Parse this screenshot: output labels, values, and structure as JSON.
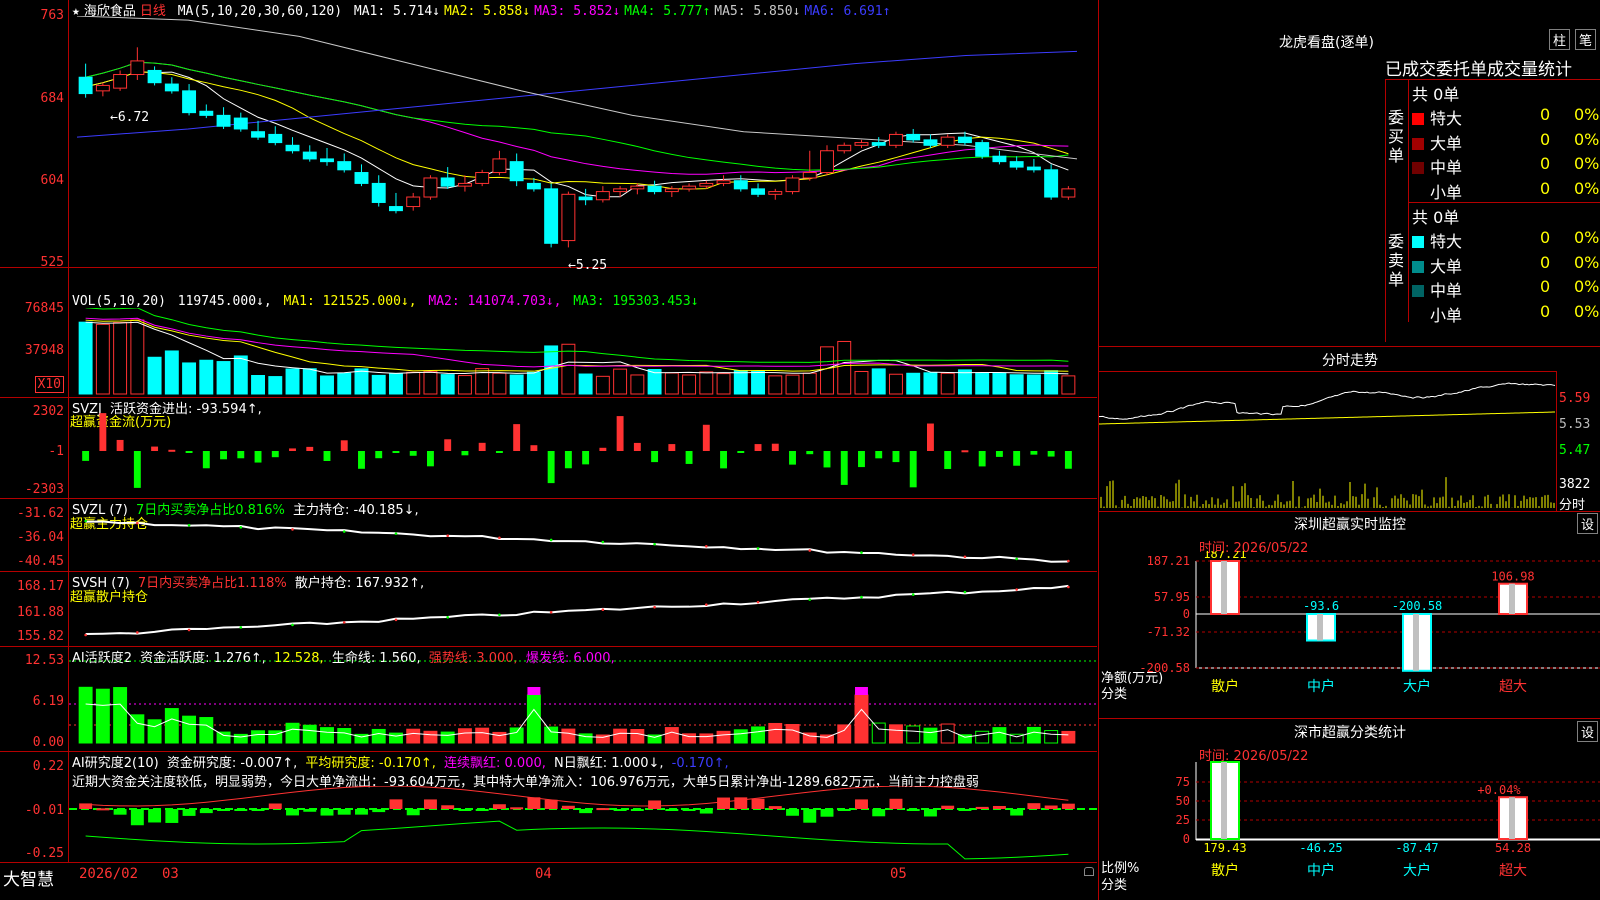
{
  "stock": {
    "star": "★",
    "name": "海欣食品",
    "period": "日线"
  },
  "kline_pane": {
    "ma_params": "MA(5,10,20,30,60,120)",
    "ma_values": [
      {
        "label": "MA1:",
        "value": "5.714↓",
        "color": "#ffffff"
      },
      {
        "label": "MA2:",
        "value": "5.858↓",
        "color": "#ffff00"
      },
      {
        "label": "MA3:",
        "value": "5.852↓",
        "color": "#ff00ff"
      },
      {
        "label": "MA4:",
        "value": "5.777↑",
        "color": "#00ff00"
      },
      {
        "label": "MA5:",
        "value": "5.850↓",
        "color": "#c8c8c8"
      },
      {
        "label": "MA6:",
        "value": "6.691↑",
        "color": "#3c3cff"
      }
    ],
    "y_ticks": [
      "763",
      "684",
      "604",
      "525"
    ],
    "annotations": {
      "high": "←6.72",
      "low": "←5.25"
    }
  },
  "vol_pane": {
    "title": "VOL(5,10,20)",
    "value": "119745.000↓,",
    "ma1": "MA1: 121525.000↓,",
    "ma2": "MA2: 141074.703↓,",
    "ma3": "MA3: 195303.453↓",
    "y_ticks": [
      "76845",
      "37948"
    ],
    "unit": "X10"
  },
  "svzj_pane": {
    "title": "SVZJ",
    "text": "活跃资金进出: -93.594↑,",
    "sub": "超赢资金流(万元)",
    "y_ticks": [
      "2302",
      "-1",
      "-2303"
    ]
  },
  "svzl_pane": {
    "title": "SVZL (7)",
    "text1": "7日内买卖净占比0.816%",
    "text2": "主力持仓: -40.185↓,",
    "sub": "超赢主力持仓",
    "y_ticks": [
      "-31.62",
      "-36.04",
      "-40.45"
    ]
  },
  "svsh_pane": {
    "title": "SVSH (7)",
    "text1": "7日内买卖净占比1.118%",
    "text2": "散户持仓: 167.932↑,",
    "sub": "超赢散户持仓",
    "y_ticks": [
      "168.17",
      "161.88",
      "155.82"
    ]
  },
  "ai_pane": {
    "title": "AI活跃度2",
    "t1": "资金活跃度: 1.276↑,",
    "t2": "12.528,",
    "t3": "生命线: 1.560,",
    "t4": "强势线: 3.000,",
    "t5": "爆发线: 6.000,",
    "y_ticks": [
      "12.53",
      "6.19",
      "0.00"
    ]
  },
  "ai2_pane": {
    "title": "AI研究度2(10)",
    "t1": "资金研究度: -0.007↑,",
    "t2": "平均研究度: -0.170↑,",
    "t3": "连续飘红: 0.000,",
    "t4": "N日飘红: 1.000↓,",
    "t5": "-0.170↑,",
    "summary": "近期大资金关注度较低，明显弱势，今日大单净流出：-93.604万元，其中特大单净流入：106.976万元，大单5日累计净出-1289.682万元，当前主力控盘弱",
    "y_ticks": [
      "0.22",
      "-0.01",
      "-0.25"
    ]
  },
  "bottom_bar": {
    "logo": "大智慧",
    "dates": [
      "2026/02",
      "03",
      "04",
      "05"
    ]
  },
  "right_panel": {
    "title": "龙虎看盘(逐单)",
    "btn1": "柱",
    "btn2": "笔",
    "tab": "已成交委托单成交量统计",
    "buy_group": {
      "label": "委买单",
      "total": "共 0单",
      "rows": [
        {
          "name": "特大",
          "count": "0",
          "pct": "0%",
          "color": "#ff0000"
        },
        {
          "name": "大单",
          "count": "0",
          "pct": "0%",
          "color": "#a00000"
        },
        {
          "name": "中单",
          "count": "0",
          "pct": "0%",
          "color": "#700000"
        },
        {
          "name": "小单",
          "count": "0",
          "pct": "0%",
          "color": "#000000"
        }
      ]
    },
    "sell_group": {
      "label": "委卖单",
      "total": "共 0单",
      "rows": [
        {
          "name": "特大",
          "count": "0",
          "pct": "0%",
          "color": "#00ffff"
        },
        {
          "name": "大单",
          "count": "0",
          "pct": "0%",
          "color": "#008c8c"
        },
        {
          "name": "中单",
          "count": "0",
          "pct": "0%",
          "color": "#006464"
        },
        {
          "name": "小单",
          "count": "0",
          "pct": "0%",
          "color": "#000000"
        }
      ]
    },
    "intraday": {
      "title": "分时走势",
      "y_ticks": [
        "5.59",
        "5.53",
        "5.47"
      ],
      "vol_tick": "3822",
      "vol_label": "分时"
    },
    "monitor": {
      "title": "深圳超赢实时监控",
      "setting": "设",
      "time": "时间: 2026/05/22",
      "y_ticks": [
        "187.21",
        "57.95",
        "0",
        "-71.32",
        "-200.58"
      ],
      "ylabel1": "净额(万元)",
      "ylabel2": "分类",
      "categories": [
        "散户",
        "中户",
        "大户",
        "超大"
      ],
      "values": [
        187.21,
        -93.6,
        -200.58,
        106.98
      ],
      "value_labels": [
        "187.21",
        "-93.6",
        "-200.58",
        "106.98"
      ]
    },
    "classify": {
      "title": "深市超赢分类统计",
      "setting": "设",
      "time": "时间: 2026/05/22",
      "y_ticks": [
        "75",
        "50",
        "25",
        "0"
      ],
      "ylabel1": "比例%",
      "ylabel2": "分类",
      "categories": [
        "散户",
        "中户",
        "大户",
        "超大"
      ],
      "pct_labels": [
        "",
        "",
        "",
        "+0.04%"
      ],
      "values": [
        179.43,
        -46.25,
        -87.47,
        54.28
      ],
      "value_labels": [
        "179.43",
        "-46.25",
        "-87.47",
        "54.28"
      ]
    }
  },
  "chart_data": {
    "type": "candlestick",
    "title": "海欣食品 日线",
    "y_range": [
      5.25,
      6.72
    ],
    "candles_ohlc": [
      [
        6.5,
        6.6,
        6.35,
        6.38
      ],
      [
        6.4,
        6.46,
        6.36,
        6.44
      ],
      [
        6.42,
        6.55,
        6.4,
        6.52
      ],
      [
        6.52,
        6.72,
        6.48,
        6.62
      ],
      [
        6.55,
        6.58,
        6.44,
        6.46
      ],
      [
        6.45,
        6.5,
        6.38,
        6.4
      ],
      [
        6.4,
        6.45,
        6.22,
        6.24
      ],
      [
        6.25,
        6.3,
        6.2,
        6.22
      ],
      [
        6.22,
        6.28,
        6.12,
        6.14
      ],
      [
        6.2,
        6.24,
        6.1,
        6.12
      ],
      [
        6.1,
        6.18,
        6.04,
        6.06
      ],
      [
        6.08,
        6.14,
        6.0,
        6.02
      ],
      [
        6.0,
        6.06,
        5.94,
        5.96
      ],
      [
        5.95,
        6.0,
        5.88,
        5.9
      ],
      [
        5.9,
        5.98,
        5.85,
        5.88
      ],
      [
        5.88,
        5.94,
        5.8,
        5.82
      ],
      [
        5.8,
        5.86,
        5.7,
        5.72
      ],
      [
        5.72,
        5.78,
        5.55,
        5.58
      ],
      [
        5.55,
        5.65,
        5.5,
        5.52
      ],
      [
        5.55,
        5.65,
        5.52,
        5.62
      ],
      [
        5.62,
        5.78,
        5.6,
        5.76
      ],
      [
        5.76,
        5.84,
        5.68,
        5.7
      ],
      [
        5.7,
        5.78,
        5.66,
        5.72
      ],
      [
        5.72,
        5.82,
        5.7,
        5.8
      ],
      [
        5.8,
        5.96,
        5.78,
        5.9
      ],
      [
        5.88,
        5.94,
        5.7,
        5.74
      ],
      [
        5.72,
        5.76,
        5.66,
        5.68
      ],
      [
        5.68,
        5.72,
        5.25,
        5.28
      ],
      [
        5.3,
        5.66,
        5.25,
        5.64
      ],
      [
        5.62,
        5.68,
        5.56,
        5.6
      ],
      [
        5.6,
        5.7,
        5.58,
        5.66
      ],
      [
        5.66,
        5.7,
        5.62,
        5.68
      ],
      [
        5.68,
        5.72,
        5.64,
        5.7
      ],
      [
        5.7,
        5.74,
        5.64,
        5.66
      ],
      [
        5.66,
        5.7,
        5.62,
        5.68
      ],
      [
        5.68,
        5.72,
        5.66,
        5.7
      ],
      [
        5.7,
        5.74,
        5.68,
        5.72
      ],
      [
        5.72,
        5.78,
        5.7,
        5.74
      ],
      [
        5.74,
        5.78,
        5.66,
        5.68
      ],
      [
        5.68,
        5.72,
        5.62,
        5.64
      ],
      [
        5.64,
        5.68,
        5.6,
        5.66
      ],
      [
        5.66,
        5.78,
        5.64,
        5.76
      ],
      [
        5.76,
        5.96,
        5.74,
        5.8
      ],
      [
        5.8,
        6.0,
        5.78,
        5.96
      ],
      [
        5.96,
        6.02,
        5.94,
        6.0
      ],
      [
        6.0,
        6.04,
        5.98,
        6.02
      ],
      [
        6.02,
        6.06,
        5.98,
        6.0
      ],
      [
        6.0,
        6.1,
        5.98,
        6.08
      ],
      [
        6.08,
        6.12,
        6.02,
        6.04
      ],
      [
        6.04,
        6.08,
        5.98,
        6.0
      ],
      [
        6.0,
        6.08,
        5.98,
        6.06
      ],
      [
        6.06,
        6.1,
        6.0,
        6.02
      ],
      [
        6.02,
        6.04,
        5.9,
        5.92
      ],
      [
        5.92,
        5.96,
        5.86,
        5.88
      ],
      [
        5.88,
        5.92,
        5.82,
        5.84
      ],
      [
        5.84,
        5.9,
        5.8,
        5.82
      ],
      [
        5.82,
        5.86,
        5.6,
        5.62
      ],
      [
        5.62,
        5.7,
        5.6,
        5.68
      ]
    ],
    "ma_series": [
      {
        "name": "MA6",
        "color": "#3c3cff",
        "values": [
          6.06,
          6.12,
          6.2,
          6.28,
          6.36,
          6.44,
          6.52,
          6.6,
          6.66,
          6.69
        ]
      },
      {
        "name": "MA5",
        "color": "#c8c8c8",
        "values": [
          6.95,
          6.92,
          6.8,
          6.6,
          6.4,
          6.22,
          6.1,
          6.05,
          6.0,
          5.9
        ]
      }
    ]
  }
}
